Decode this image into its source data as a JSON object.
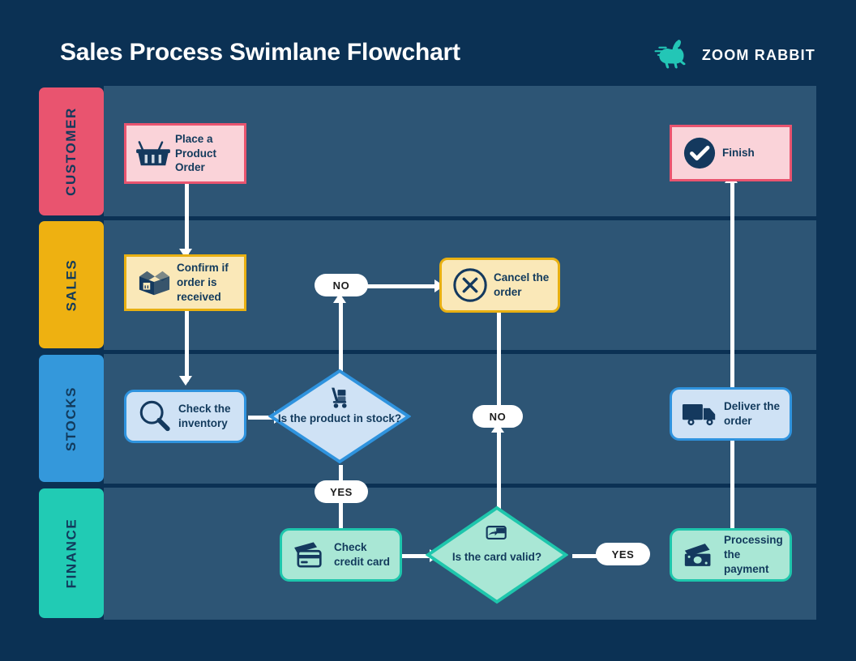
{
  "header": {
    "title": "Sales Process Swimlane Flowchart",
    "brand_name": "ZOOM RABBIT",
    "brand_icon": "rabbit-icon",
    "brand_color": "#23c6b6"
  },
  "colors": {
    "page_background": "#0b3154",
    "lane_background": "#2d5575",
    "lane_divider": "#0b3154",
    "connector": "#ffffff",
    "node_text": "#123a5c",
    "customer_fill": "#fad3d9",
    "customer_border": "#e9546f",
    "sales_fill": "#fae8b8",
    "sales_border": "#e8b012",
    "stocks_fill": "#cfe2f5",
    "stocks_border": "#2f93de",
    "finance_fill": "#a9e7d5",
    "finance_border": "#1ec6ac"
  },
  "lanes": [
    {
      "label": "CUSTOMER",
      "color": "#e9546f"
    },
    {
      "label": "SALES",
      "color": "#eeb111"
    },
    {
      "label": "STOCKS",
      "color": "#3498db"
    },
    {
      "label": "FINANCE",
      "color": "#21cbb4"
    }
  ],
  "nodes": [
    {
      "id": "place-order",
      "lane": "CUSTOMER",
      "shape": "rectangle",
      "label": "Place a Product Order",
      "icon": "shopping-basket-icon"
    },
    {
      "id": "finish",
      "lane": "CUSTOMER",
      "shape": "rectangle",
      "label": "Finish",
      "icon": "check-circle-icon"
    },
    {
      "id": "confirm-order",
      "lane": "SALES",
      "shape": "rectangle",
      "label": "Confirm if order is received",
      "icon": "package-box-icon"
    },
    {
      "id": "cancel-order",
      "lane": "SALES",
      "shape": "rounded",
      "label": "Cancel the order",
      "icon": "x-circle-icon"
    },
    {
      "id": "check-inventory",
      "lane": "STOCKS",
      "shape": "rounded",
      "label": "Check the inventory",
      "icon": "magnifier-icon"
    },
    {
      "id": "product-stock",
      "lane": "STOCKS",
      "shape": "diamond",
      "label": "Is the product in stock?",
      "icon": "hand-truck-icon"
    },
    {
      "id": "deliver-order",
      "lane": "STOCKS",
      "shape": "rounded",
      "label": "Deliver the order",
      "icon": "delivery-truck-icon"
    },
    {
      "id": "check-card",
      "lane": "FINANCE",
      "shape": "rounded",
      "label": "Check credit card",
      "icon": "credit-card-icon"
    },
    {
      "id": "card-valid",
      "lane": "FINANCE",
      "shape": "diamond",
      "label": "Is the card valid?",
      "icon": "card-payment-icon"
    },
    {
      "id": "processing",
      "lane": "FINANCE",
      "shape": "rounded",
      "label": "Processing the payment",
      "icon": "money-icon"
    }
  ],
  "decision_labels": [
    {
      "id": "stock-no",
      "text": "NO",
      "from": "product-stock",
      "to": "cancel-order"
    },
    {
      "id": "stock-yes",
      "text": "YES",
      "from": "product-stock",
      "to": "check-card"
    },
    {
      "id": "card-no",
      "text": "NO",
      "from": "card-valid",
      "to": "cancel-order"
    },
    {
      "id": "card-yes",
      "text": "YES",
      "from": "card-valid",
      "to": "processing"
    }
  ],
  "chart_data": {
    "type": "diagram",
    "diagram_type": "swimlane-flowchart",
    "title": "Sales Process Swimlane Flowchart",
    "lanes": [
      "CUSTOMER",
      "SALES",
      "STOCKS",
      "FINANCE"
    ],
    "edges": [
      {
        "from": "place-order",
        "to": "confirm-order",
        "label": ""
      },
      {
        "from": "confirm-order",
        "to": "check-inventory",
        "label": ""
      },
      {
        "from": "check-inventory",
        "to": "product-stock",
        "label": ""
      },
      {
        "from": "product-stock",
        "to": "cancel-order",
        "label": "NO"
      },
      {
        "from": "product-stock",
        "to": "check-card",
        "label": "YES"
      },
      {
        "from": "check-card",
        "to": "card-valid",
        "label": ""
      },
      {
        "from": "card-valid",
        "to": "cancel-order",
        "label": "NO"
      },
      {
        "from": "card-valid",
        "to": "processing",
        "label": "YES"
      },
      {
        "from": "processing",
        "to": "deliver-order",
        "label": ""
      },
      {
        "from": "deliver-order",
        "to": "finish",
        "label": ""
      }
    ]
  }
}
